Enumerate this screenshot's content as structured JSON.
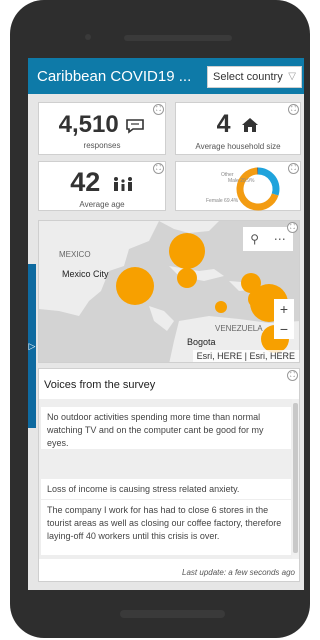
{
  "header": {
    "title": "Caribbean COVID19 ...",
    "country_select": "Select country"
  },
  "kpis": {
    "responses": {
      "value": "4,510",
      "label": "responses",
      "icon": "speech-bubble-icon"
    },
    "household": {
      "value": "4",
      "label": "Average household size",
      "icon": "house-icon"
    },
    "age": {
      "value": "42",
      "label": "Average age",
      "icon": "family-icon"
    }
  },
  "gender_chart": {
    "labels": [
      "Other",
      "Male 29.9%",
      "Female 69.4%"
    ],
    "colors": {
      "female": "#f39c12",
      "male": "#1fa3dc",
      "other": "#555555"
    },
    "chart_data": {
      "type": "pie",
      "categories": [
        "Female",
        "Male",
        "Other"
      ],
      "values": [
        69.4,
        29.9,
        0.7
      ]
    }
  },
  "map": {
    "labels": {
      "mexico": "MEXICO",
      "mexico_city": "Mexico City",
      "venezuela": "VENEZUELA",
      "bogota": "Bogota"
    },
    "attribution": "Esri, HERE | Esri, HERE",
    "zoom_in": "+",
    "zoom_out": "−",
    "marker_color": "#f7a000"
  },
  "voices": {
    "title": "Voices from the survey",
    "items": [
      "No outdoor activities spending more time than normal watching TV and on the computer cant be good for my eyes.",
      "Loss of income is causing stress related anxiety.",
      "The company I work for has had to close 6 stores in the tourist areas as well as closing our coffee factory, therefore laying-off 40 workers until this crisis is over."
    ],
    "last_update": "Last update: a few seconds ago"
  },
  "colors": {
    "header": "#0e7aa8",
    "accent": "#f39c12"
  }
}
